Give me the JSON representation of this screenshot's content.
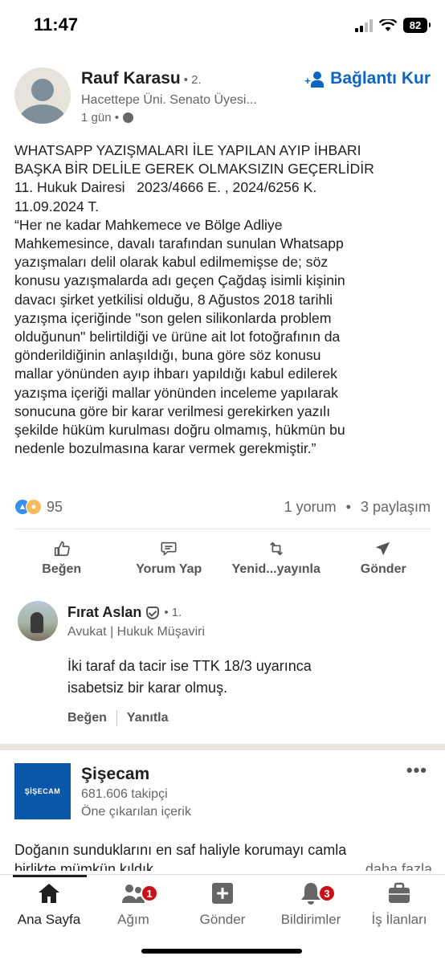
{
  "status": {
    "time": "11:47",
    "battery": "82"
  },
  "post": {
    "author": {
      "name": "Rauf Karasu",
      "degree": "• 2.",
      "headline": "Hacettepe Üni. Senato Üyesi...",
      "time": "1 gün •"
    },
    "connect_label": "Bağlantı Kur",
    "text_lines": [
      "WHATSAPP YAZIŞMALARI İLE YAPILAN AYIP İHBARI",
      "BAŞKA BİR DELİLE GEREK OLMAKSIZIN GEÇERLİDİR",
      "11. Hukuk Dairesi   2023/4666 E. , 2024/6256 K.",
      "11.09.2024 T.",
      "“Her ne kadar Mahkemece ve Bölge Adliye",
      "Mahkemesince, davalı tarafından sunulan Whatsapp",
      "yazışmaları delil olarak kabul edilmemişse de; söz",
      "konusu yazışmalarda adı geçen Çağdaş isimli kişinin",
      "davacı şirket yetkilisi olduğu, 8 Ağustos 2018 tarihli",
      "yazışma içeriğinde \"son gelen silikonlarda problem",
      "olduğunun\" belirtildiği ve ürüne ait lot fotoğrafının da",
      "gönderildiğinin anlaşıldığı, buna göre söz konusu",
      "mallar yönünden ayıp ihbarı yapıldığı kabul edilerek",
      "yazışma içeriği mallar yönünden inceleme yapılarak",
      "sonucuna göre bir karar verilmesi gerekirken yazılı",
      "şekilde hüküm kurulması doğru olmamış, hükmün bu",
      "nedenle bozulmasına karar vermek gerekmiştir.”"
    ],
    "reaction_count": "95",
    "comments_count": "1 yorum",
    "dot": "•",
    "shares_count": "3 paylaşım",
    "actions": {
      "like": "Beğen",
      "comment": "Yorum Yap",
      "repost": "Yenid...yayınla",
      "send": "Gönder"
    }
  },
  "comment": {
    "name": "Fırat Aslan",
    "degree": "• 1.",
    "headline": "Avukat | Hukuk Müşaviri",
    "text_line1": "İki taraf da tacir ise TTK 18/3 uyarınca",
    "text_line2": "isabetsiz bir karar olmuş.",
    "like": "Beğen",
    "reply": "Yanıtla"
  },
  "ad": {
    "logo_text": "ŞİŞECAM",
    "name": "Şişecam",
    "followers": "681.606 takipçi",
    "promoted": "Öne çıkarılan içerik",
    "more": "•••",
    "text_line1": "Doğanın sunduklarını en saf haliyle korumayı camla",
    "text_line2": "birlikte mümkün kıldık",
    "see_more": "daha fazla"
  },
  "tabbar": {
    "home": "Ana Sayfa",
    "network": "Ağım",
    "network_badge": "1",
    "post": "Gönder",
    "notifications": "Bildirimler",
    "notifications_badge": "3",
    "jobs": "İş İlanları"
  },
  "colors": {
    "accent": "#0a66c2",
    "badge": "#cc1016",
    "ad_brand": "#0a56a8"
  }
}
